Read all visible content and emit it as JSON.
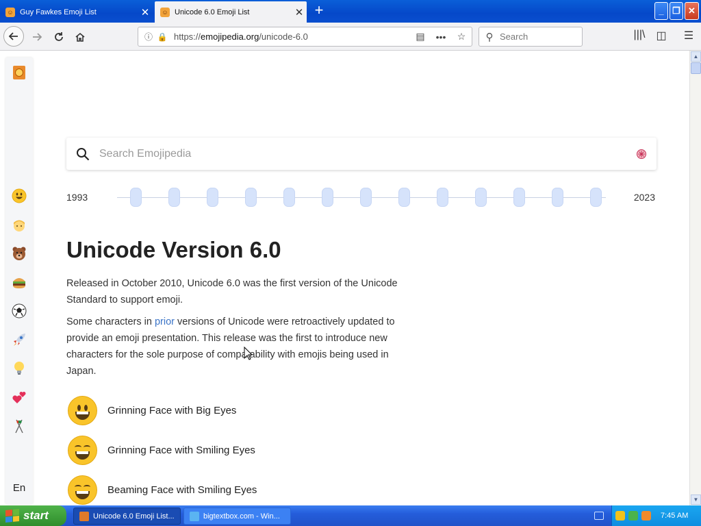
{
  "browser": {
    "tabs": [
      {
        "title": "Guy Fawkes Emoji List",
        "active": false
      },
      {
        "title": "Unicode 6.0 Emoji List",
        "active": true
      }
    ],
    "url_prefix": "https://",
    "url_host": "emojipedia.org",
    "url_path": "/unicode-6.0",
    "search_placeholder": "Search"
  },
  "page": {
    "search_placeholder": "Search Emojipedia",
    "timeline": {
      "start_year": "1993",
      "end_year": "2023",
      "version_count": 13
    },
    "title": "Unicode Version 6.0",
    "paragraph1": "Released in October 2010, Unicode 6.0 was the first version of the Unicode Standard to support emoji.",
    "paragraph2_before": "Some characters in ",
    "paragraph2_link": "prior",
    "paragraph2_after": " versions of Unicode were retroactively updated to provide an emoji presentation. This release was the first to introduce new characters for the sole purpose of compatability with emojis being used in Japan.",
    "emojis": [
      {
        "name": "Grinning Face with Big Eyes"
      },
      {
        "name": "Grinning Face with Smiling Eyes"
      },
      {
        "name": "Beaming Face with Smiling Eyes"
      }
    ],
    "sidebar": {
      "categories": [
        "smileys",
        "people",
        "animals",
        "food",
        "activities",
        "travel",
        "objects",
        "symbols",
        "flags"
      ],
      "language": "En"
    }
  },
  "taskbar": {
    "start_label": "start",
    "tasks": [
      {
        "label": "Unicode 6.0 Emoji List..."
      },
      {
        "label": "bigtextbox.com - Win..."
      }
    ],
    "clock": "7:45 AM"
  },
  "colors": {
    "link": "#3b74c7",
    "accent": "#0548c9",
    "emoji_yellow": "#f9c42a"
  }
}
